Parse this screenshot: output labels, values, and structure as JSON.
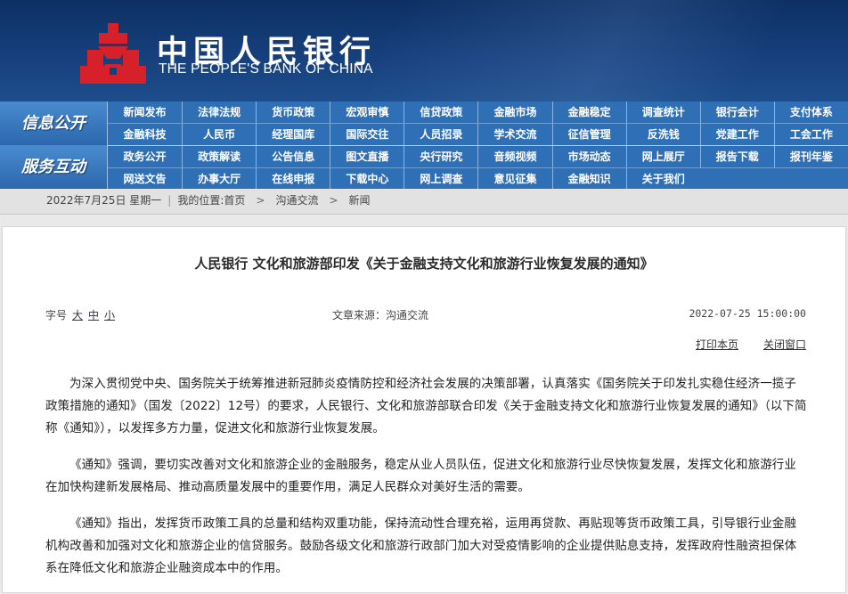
{
  "header": {
    "logo_cn": "中国人民银行",
    "logo_en": "THE PEOPLE'S BANK OF CHINA",
    "emblem_icon": "pboc-emblem-icon",
    "colors": {
      "bg": "#15407c",
      "emblem_red": "#d6202a"
    }
  },
  "nav": {
    "section1": "信息公开",
    "section2": "服务互动",
    "rows": [
      [
        "新闻发布",
        "法律法规",
        "货币政策",
        "宏观审慎",
        "信贷政策",
        "金融市场",
        "金融稳定",
        "调查统计",
        "银行会计",
        "支付体系"
      ],
      [
        "金融科技",
        "人民币",
        "经理国库",
        "国际交往",
        "人员招录",
        "学术交流",
        "征信管理",
        "反洗钱",
        "党建工作",
        "工会工作"
      ],
      [
        "政务公开",
        "政策解读",
        "公告信息",
        "图文直播",
        "央行研究",
        "音频视频",
        "市场动态",
        "网上展厅",
        "报告下载",
        "报刊年鉴"
      ],
      [
        "网送文告",
        "办事大厅",
        "在线申报",
        "下载中心",
        "网上调查",
        "意见征集",
        "金融知识",
        "关于我们"
      ]
    ]
  },
  "breadcrumb": {
    "date": "2022年7月25日 星期一",
    "location_label": "我的位置:",
    "home": "首页",
    "level1": "沟通交流",
    "level2": "新闻"
  },
  "article": {
    "title": "人民银行  文化和旅游部印发《关于金融支持文化和旅游行业恢复发展的通知》",
    "font_label": "字号",
    "font_sizes": [
      "大",
      "中",
      "小"
    ],
    "source": "文章来源：沟通交流",
    "datetime": "2022-07-25 15:00:00",
    "print_label": "打印本页",
    "close_label": "关闭窗口",
    "paragraphs": [
      "为深入贯彻党中央、国务院关于统筹推进新冠肺炎疫情防控和经济社会发展的决策部署，认真落实《国务院关于印发扎实稳住经济一揽子政策措施的通知》（国发〔2022〕12号）的要求，人民银行、文化和旅游部联合印发《关于金融支持文化和旅游行业恢复发展的通知》（以下简称《通知》），以发挥多方力量，促进文化和旅游行业恢复发展。",
      "《通知》强调，要切实改善对文化和旅游企业的金融服务，稳定从业人员队伍，促进文化和旅游行业尽快恢复发展，发挥文化和旅游行业在加快构建新发展格局、推动高质量发展中的重要作用，满足人民群众对美好生活的需要。",
      "《通知》指出，发挥货币政策工具的总量和结构双重功能，保持流动性合理充裕，运用再贷款、再贴现等货币政策工具，引导银行业金融机构改善和加强对文化和旅游企业的信贷服务。鼓励各级文化和旅游行政部门加大对受疫情影响的企业提供贴息支持，发挥政府性融资担保体系在降低文化和旅游企业融资成本中的作用。"
    ]
  }
}
